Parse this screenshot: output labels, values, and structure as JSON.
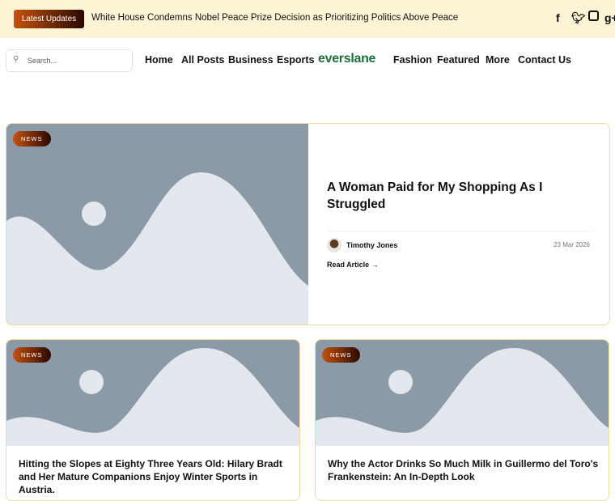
{
  "topbar": {
    "badge": "Latest Updates",
    "headline": "White House Condemns Nobel Peace Prize Decision as Prioritizing Politics Above Peace",
    "social": [
      "f",
      "t",
      "ig",
      "g+"
    ]
  },
  "search": {
    "placeholder": "Search..."
  },
  "nav": {
    "items": [
      "Home",
      "All Posts",
      "Business",
      "Esports",
      "Fashion",
      "Featured",
      "More",
      "Contact Us"
    ],
    "logo": "everslane"
  },
  "featured": {
    "tag": "NEWS",
    "title": "A Woman Paid for My Shopping As I Struggled",
    "author": "Timothy Jones",
    "date": "23 Mar 2026",
    "read_more": "Read Article"
  },
  "posts": [
    {
      "tag": "NEWS",
      "title": "Hitting the Slopes at Eighty Three Years Old: Hilary Bradt and Her Mature Companions Enjoy Winter Sports in Austria."
    },
    {
      "tag": "NEWS",
      "title": "Why the Actor Drinks So Much Milk in Guillermo del Toro's Frankenstein: An In-Depth Look"
    }
  ]
}
